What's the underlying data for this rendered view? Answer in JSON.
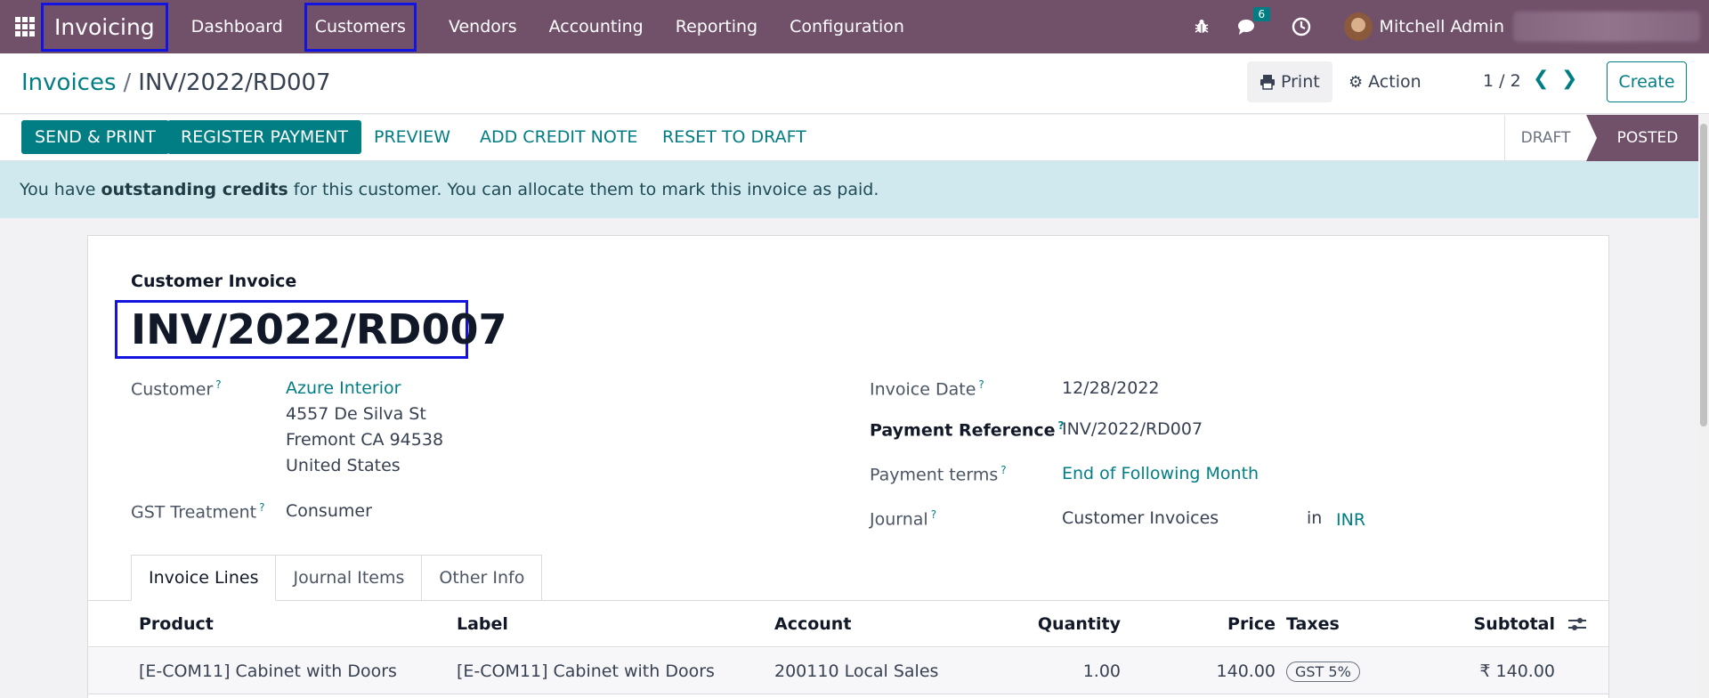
{
  "navbar": {
    "app_name": "Invoicing",
    "menu": [
      "Dashboard",
      "Customers",
      "Vendors",
      "Accounting",
      "Reporting",
      "Configuration"
    ],
    "message_count": "6",
    "user_name": "Mitchell Admin"
  },
  "control_panel": {
    "breadcrumb_parent": "Invoices",
    "breadcrumb_separator": "/",
    "breadcrumb_current": "INV/2022/RD007",
    "print_label": "Print",
    "action_label": "Action",
    "pager": "1 / 2",
    "create_label": "Create"
  },
  "statusbar": {
    "buttons": [
      "SEND & PRINT",
      "REGISTER PAYMENT",
      "PREVIEW",
      "ADD CREDIT NOTE",
      "RESET TO DRAFT"
    ],
    "stages": [
      "DRAFT",
      "POSTED"
    ],
    "active_stage": "POSTED"
  },
  "alert": {
    "prefix": "You have ",
    "bold": "outstanding credits",
    "suffix": " for this customer. You can allocate them to mark this invoice as paid."
  },
  "form": {
    "doc_type": "Customer Invoice",
    "number": "INV/2022/RD007",
    "customer_label": "Customer",
    "customer_name": "Azure Interior",
    "customer_address": [
      "4557 De Silva St",
      "Fremont CA 94538",
      "United States"
    ],
    "gst_label": "GST Treatment",
    "gst_value": "Consumer",
    "invoice_date_label": "Invoice Date",
    "invoice_date_value": "12/28/2022",
    "payment_ref_label": "Payment Reference",
    "payment_ref_value": "INV/2022/RD007",
    "payment_terms_label": "Payment terms",
    "payment_terms_value": "End of Following Month",
    "journal_label": "Journal",
    "journal_value": "Customer Invoices",
    "journal_in": "in",
    "currency": "INR",
    "help_mark": "?"
  },
  "tabs": [
    "Invoice Lines",
    "Journal Items",
    "Other Info"
  ],
  "table": {
    "headers": [
      "Product",
      "Label",
      "Account",
      "Quantity",
      "Price",
      "Taxes",
      "Subtotal"
    ],
    "rows": [
      {
        "product": "[E-COM11] Cabinet with Doors",
        "label": "[E-COM11] Cabinet with Doors",
        "account": "200110 Local Sales",
        "quantity": "1.00",
        "price": "140.00",
        "taxes": "GST 5%",
        "subtotal": "₹ 140.00"
      }
    ]
  },
  "colors": {
    "navbar": "#71506a",
    "primary": "#017e84",
    "alert_bg": "#cfe9ee"
  }
}
